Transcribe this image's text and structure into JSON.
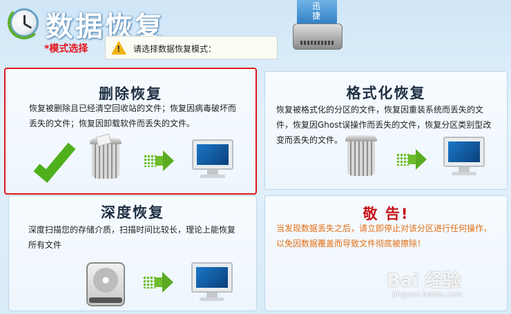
{
  "header": {
    "title": "数据恢复",
    "drive_label": "迅\n捷",
    "mode_label": "*模式选择",
    "mode_hint": "请选择数据恢复模式："
  },
  "cards": {
    "delete": {
      "title": "删除恢复",
      "desc": "恢复被删除且已经清空回收站的文件；恢复因病毒破坏而丢失的文件；恢复因卸载软件而丢失的文件。"
    },
    "format": {
      "title": "格式化恢复",
      "desc": "恢复被格式化的分区的文件，恢复因重装系统而丢失的文件，恢复因Ghost误操作而丢失的文件，恢复分区类别型改变而丢失的文件。"
    },
    "deep": {
      "title": "深度恢复",
      "desc": "深度扫描您的存储介质，扫描时间比较长，理论上能恢复所有文件"
    },
    "warning": {
      "title": "敬 告!",
      "desc": "当发现数据丢失之后，请立即停止对该分区进行任何操作，以免因数据覆盖而导致文件彻底被擦除！"
    }
  },
  "watermark": {
    "text": "Bai 经验",
    "sub": "jingyan.baidu.com"
  }
}
